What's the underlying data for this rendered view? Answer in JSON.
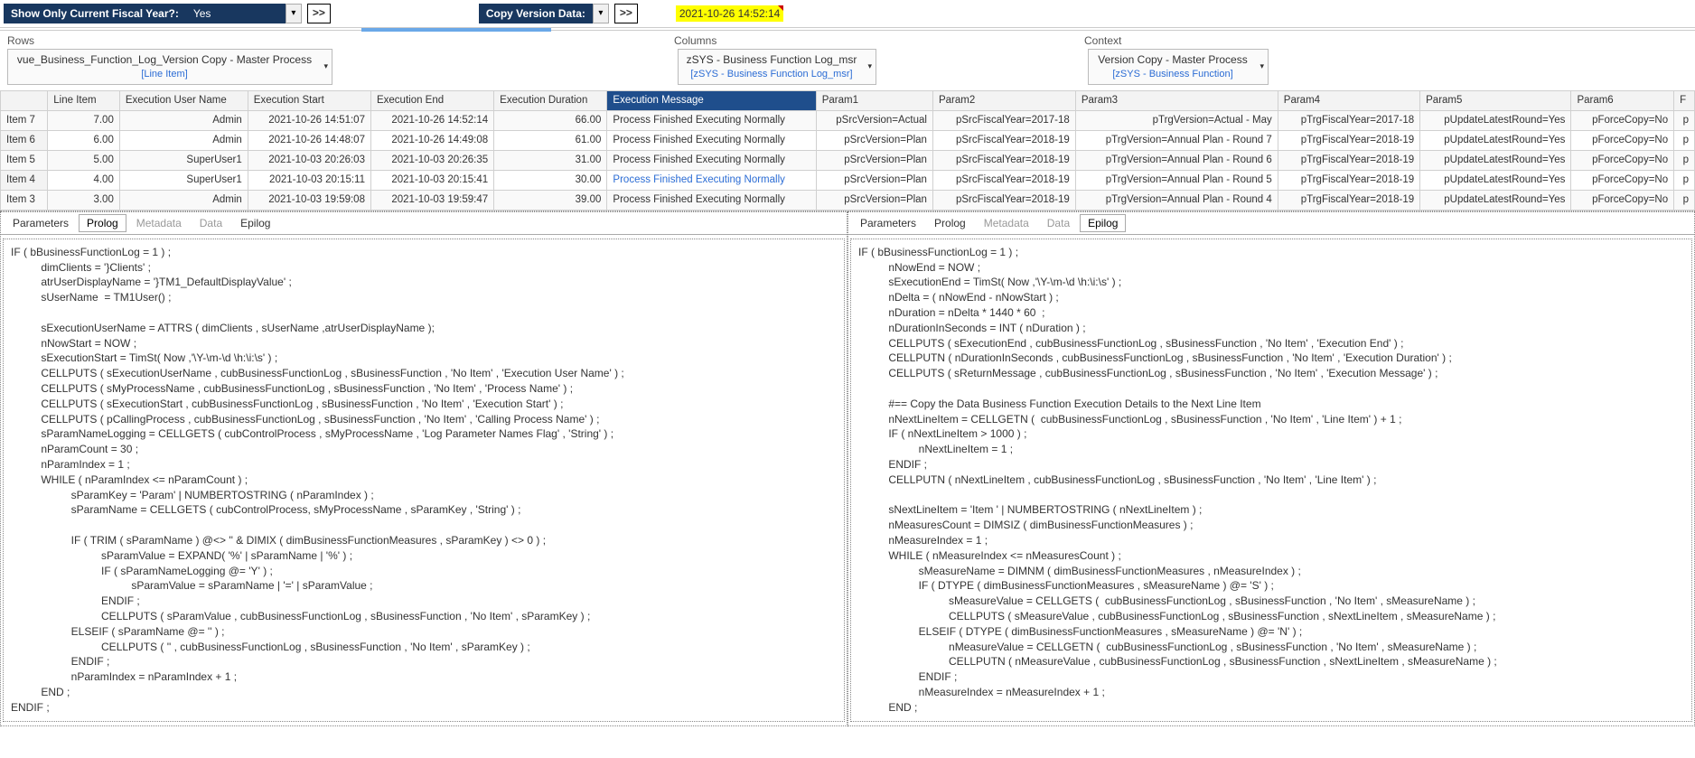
{
  "toolbar": {
    "fiscal_label": "Show Only Current Fiscal Year?:",
    "fiscal_value": "Yes",
    "go_glyph": ">>",
    "copy_label": "Copy Version Data:",
    "timestamp": "2021-10-26 14:52:14"
  },
  "sections": {
    "rows_label": "Rows",
    "cols_label": "Columns",
    "ctx_label": "Context"
  },
  "dims": {
    "rows_main": "vue_Business_Function_Log_Version Copy - Master Process",
    "rows_sub": "[Line Item]",
    "cols_main": "zSYS - Business Function Log_msr",
    "cols_sub": "[zSYS - Business Function Log_msr]",
    "ctx_main": "Version Copy - Master Process",
    "ctx_sub": "[zSYS - Business Function]"
  },
  "grid": {
    "headers": [
      "",
      "Line Item",
      "Execution User Name",
      "Execution Start",
      "Execution End",
      "Execution Duration",
      "Execution Message",
      "Param1",
      "Param2",
      "Param3",
      "Param4",
      "Param5",
      "Param6",
      "F"
    ],
    "rows": [
      {
        "item": "Item 7",
        "line": "7.00",
        "user": "Admin",
        "start": "2021-10-26 14:51:07",
        "end": "2021-10-26 14:52:14",
        "dur": "66.00",
        "msg": "Process Finished Executing Normally",
        "p1": "pSrcVersion=Actual",
        "p2": "pSrcFiscalYear=2017-18",
        "p3": "pTrgVersion=Actual - May",
        "p4": "pTrgFiscalYear=2017-18",
        "p5": "pUpdateLatestRound=Yes",
        "p6": "pForceCopy=No",
        "p7": "p",
        "link": false
      },
      {
        "item": "Item 6",
        "line": "6.00",
        "user": "Admin",
        "start": "2021-10-26 14:48:07",
        "end": "2021-10-26 14:49:08",
        "dur": "61.00",
        "msg": "Process Finished Executing Normally",
        "p1": "pSrcVersion=Plan",
        "p2": "pSrcFiscalYear=2018-19",
        "p3": "pTrgVersion=Annual Plan - Round 7",
        "p4": "pTrgFiscalYear=2018-19",
        "p5": "pUpdateLatestRound=Yes",
        "p6": "pForceCopy=No",
        "p7": "p",
        "link": false
      },
      {
        "item": "Item 5",
        "line": "5.00",
        "user": "SuperUser1",
        "start": "2021-10-03 20:26:03",
        "end": "2021-10-03 20:26:35",
        "dur": "31.00",
        "msg": "Process Finished Executing Normally",
        "p1": "pSrcVersion=Plan",
        "p2": "pSrcFiscalYear=2018-19",
        "p3": "pTrgVersion=Annual Plan - Round 6",
        "p4": "pTrgFiscalYear=2018-19",
        "p5": "pUpdateLatestRound=Yes",
        "p6": "pForceCopy=No",
        "p7": "p",
        "link": false
      },
      {
        "item": "Item 4",
        "line": "4.00",
        "user": "SuperUser1",
        "start": "2021-10-03 20:15:11",
        "end": "2021-10-03 20:15:41",
        "dur": "30.00",
        "msg": "Process Finished Executing Normally",
        "p1": "pSrcVersion=Plan",
        "p2": "pSrcFiscalYear=2018-19",
        "p3": "pTrgVersion=Annual Plan - Round 5",
        "p4": "pTrgFiscalYear=2018-19",
        "p5": "pUpdateLatestRound=Yes",
        "p6": "pForceCopy=No",
        "p7": "p",
        "link": true
      },
      {
        "item": "Item 3",
        "line": "3.00",
        "user": "Admin",
        "start": "2021-10-03 19:59:08",
        "end": "2021-10-03 19:59:47",
        "dur": "39.00",
        "msg": "Process Finished Executing Normally",
        "p1": "pSrcVersion=Plan",
        "p2": "pSrcFiscalYear=2018-19",
        "p3": "pTrgVersion=Annual Plan - Round 4",
        "p4": "pTrgFiscalYear=2018-19",
        "p5": "pUpdateLatestRound=Yes",
        "p6": "pForceCopy=No",
        "p7": "p",
        "link": false
      }
    ]
  },
  "tabs": {
    "parameters": "Parameters",
    "prolog": "Prolog",
    "metadata": "Metadata",
    "data": "Data",
    "epilog": "Epilog"
  },
  "code_prolog": "IF ( bBusinessFunctionLog = 1 ) ;\n          dimClients = '}Clients' ;\n          atrUserDisplayName = '}TM1_DefaultDisplayValue' ;\n          sUserName  = TM1User() ;\n\n          sExecutionUserName = ATTRS ( dimClients , sUserName ,atrUserDisplayName );\n          nNowStart = NOW ;\n          sExecutionStart = TimSt( Now ,'\\Y-\\m-\\d \\h:\\i:\\s' ) ;\n          CELLPUTS ( sExecutionUserName , cubBusinessFunctionLog , sBusinessFunction , 'No Item' , 'Execution User Name' ) ;\n          CELLPUTS ( sMyProcessName , cubBusinessFunctionLog , sBusinessFunction , 'No Item' , 'Process Name' ) ;\n          CELLPUTS ( sExecutionStart , cubBusinessFunctionLog , sBusinessFunction , 'No Item' , 'Execution Start' ) ;\n          CELLPUTS ( pCallingProcess , cubBusinessFunctionLog , sBusinessFunction , 'No Item' , 'Calling Process Name' ) ;\n          sParamNameLogging = CELLGETS ( cubControlProcess , sMyProcessName , 'Log Parameter Names Flag' , 'String' ) ;\n          nParamCount = 30 ;\n          nParamIndex = 1 ;\n          WHILE ( nParamIndex <= nParamCount ) ;\n                    sParamKey = 'Param' | NUMBERTOSTRING ( nParamIndex ) ;\n                    sParamName = CELLGETS ( cubControlProcess, sMyProcessName , sParamKey , 'String' ) ;\n\n                    IF ( TRIM ( sParamName ) @<> '' & DIMIX ( dimBusinessFunctionMeasures , sParamKey ) <> 0 ) ;\n                              sParamValue = EXPAND( '%' | sParamName | '%' ) ;\n                              IF ( sParamNameLogging @= 'Y' ) ;\n                                        sParamValue = sParamName | '=' | sParamValue ;\n                              ENDIF ;\n                              CELLPUTS ( sParamValue , cubBusinessFunctionLog , sBusinessFunction , 'No Item' , sParamKey ) ;\n                    ELSEIF ( sParamName @= '' ) ;\n                              CELLPUTS ( '' , cubBusinessFunctionLog , sBusinessFunction , 'No Item' , sParamKey ) ;\n                    ENDIF ;\n                    nParamIndex = nParamIndex + 1 ;\n          END ;\nENDIF ;",
  "code_epilog": "IF ( bBusinessFunctionLog = 1 ) ;\n          nNowEnd = NOW ;\n          sExecutionEnd = TimSt( Now ,'\\Y-\\m-\\d \\h:\\i:\\s' ) ;\n          nDelta = ( nNowEnd - nNowStart ) ;\n          nDuration = nDelta * 1440 * 60  ;\n          nDurationInSeconds = INT ( nDuration ) ;\n          CELLPUTS ( sExecutionEnd , cubBusinessFunctionLog , sBusinessFunction , 'No Item' , 'Execution End' ) ;\n          CELLPUTN ( nDurationInSeconds , cubBusinessFunctionLog , sBusinessFunction , 'No Item' , 'Execution Duration' ) ;\n          CELLPUTS ( sReturnMessage , cubBusinessFunctionLog , sBusinessFunction , 'No Item' , 'Execution Message' ) ;\n\n          #== Copy the Data Business Function Execution Details to the Next Line Item\n          nNextLineItem = CELLGETN (  cubBusinessFunctionLog , sBusinessFunction , 'No Item' , 'Line Item' ) + 1 ;\n          IF ( nNextLineItem > 1000 ) ;\n                    nNextLineItem = 1 ;\n          ENDIF ;\n          CELLPUTN ( nNextLineItem , cubBusinessFunctionLog , sBusinessFunction , 'No Item' , 'Line Item' ) ;\n\n          sNextLineItem = 'Item ' | NUMBERTOSTRING ( nNextLineItem ) ;\n          nMeasuresCount = DIMSIZ ( dimBusinessFunctionMeasures ) ;\n          nMeasureIndex = 1 ;\n          WHILE ( nMeasureIndex <= nMeasuresCount ) ;\n                    sMeasureName = DIMNM ( dimBusinessFunctionMeasures , nMeasureIndex ) ;\n                    IF ( DTYPE ( dimBusinessFunctionMeasures , sMeasureName ) @= 'S' ) ;\n                              sMeasureValue = CELLGETS (  cubBusinessFunctionLog , sBusinessFunction , 'No Item' , sMeasureName ) ;\n                              CELLPUTS ( sMeasureValue , cubBusinessFunctionLog , sBusinessFunction , sNextLineItem , sMeasureName ) ;\n                    ELSEIF ( DTYPE ( dimBusinessFunctionMeasures , sMeasureName ) @= 'N' ) ;\n                              nMeasureValue = CELLGETN (  cubBusinessFunctionLog , sBusinessFunction , 'No Item' , sMeasureName ) ;\n                              CELLPUTN ( nMeasureValue , cubBusinessFunctionLog , sBusinessFunction , sNextLineItem , sMeasureName ) ;\n                    ENDIF ;\n                    nMeasureIndex = nMeasureIndex + 1 ;\n          END ;"
}
